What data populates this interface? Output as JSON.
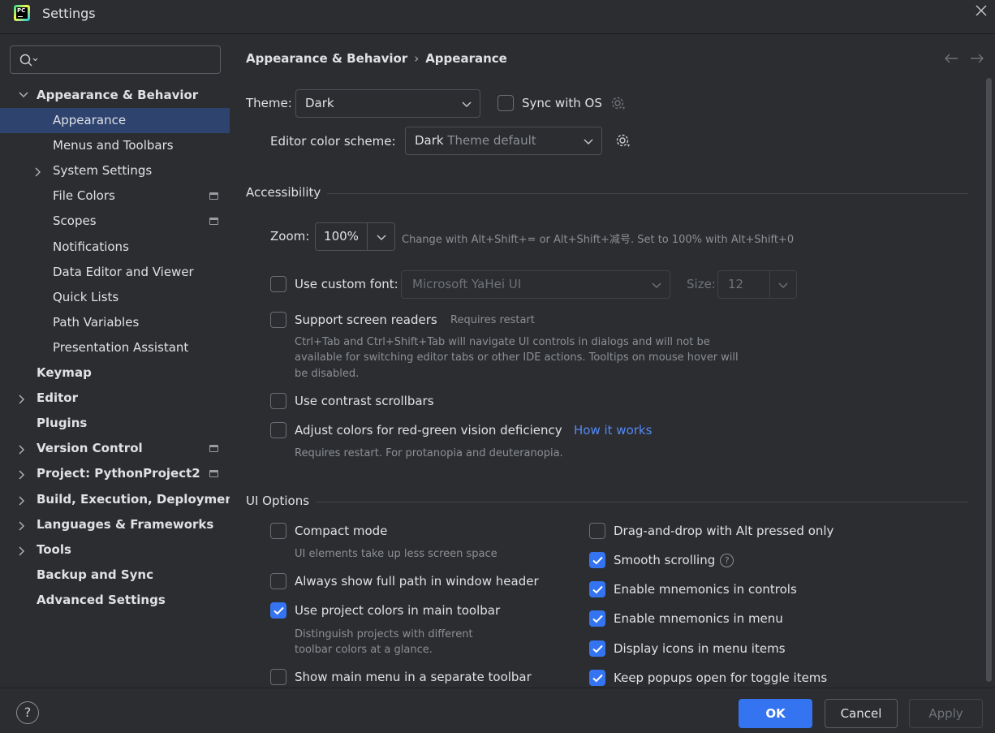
{
  "window": {
    "title": "Settings",
    "app_icon_text": "PC"
  },
  "search": {
    "value": "",
    "placeholder": ""
  },
  "sidebar": {
    "items": [
      {
        "label": "Appearance & Behavior",
        "bold": true,
        "expanded": true,
        "level": 0
      },
      {
        "label": "Appearance",
        "level": 1,
        "selected": true
      },
      {
        "label": "Menus and Toolbars",
        "level": 1
      },
      {
        "label": "System Settings",
        "level": 1,
        "has_children": true
      },
      {
        "label": "File Colors",
        "level": 1,
        "project_scoped": true
      },
      {
        "label": "Scopes",
        "level": 1,
        "project_scoped": true
      },
      {
        "label": "Notifications",
        "level": 1
      },
      {
        "label": "Data Editor and Viewer",
        "level": 1
      },
      {
        "label": "Quick Lists",
        "level": 1
      },
      {
        "label": "Path Variables",
        "level": 1
      },
      {
        "label": "Presentation Assistant",
        "level": 1
      },
      {
        "label": "Keymap",
        "bold": true,
        "level": 0
      },
      {
        "label": "Editor",
        "bold": true,
        "level": 0,
        "has_children": true
      },
      {
        "label": "Plugins",
        "bold": true,
        "level": 0
      },
      {
        "label": "Version Control",
        "bold": true,
        "level": 0,
        "has_children": true,
        "project_scoped": true
      },
      {
        "label": "Project: PythonProject2",
        "bold": true,
        "level": 0,
        "has_children": true,
        "project_scoped": true
      },
      {
        "label": "Build, Execution, Deployment",
        "bold": true,
        "level": 0,
        "has_children": true
      },
      {
        "label": "Languages & Frameworks",
        "bold": true,
        "level": 0,
        "has_children": true
      },
      {
        "label": "Tools",
        "bold": true,
        "level": 0,
        "has_children": true
      },
      {
        "label": "Backup and Sync",
        "bold": true,
        "level": 0
      },
      {
        "label": "Advanced Settings",
        "bold": true,
        "level": 0
      }
    ]
  },
  "breadcrumb": {
    "parent": "Appearance & Behavior",
    "separator": "›",
    "current": "Appearance",
    "back_icon": "arrow-left-icon",
    "forward_icon": "arrow-right-icon"
  },
  "theme": {
    "label": "Theme:",
    "value": "Dark",
    "sync_label": "Sync with OS",
    "sync_checked": false
  },
  "editor_scheme": {
    "label": "Editor color scheme:",
    "value_main": "Dark",
    "value_suffix": "Theme default"
  },
  "accessibility": {
    "title": "Accessibility",
    "zoom_label": "Zoom:",
    "zoom_value": "100%",
    "zoom_hint": "Change with Alt+Shift+= or Alt+Shift+减号. Set to 100% with Alt+Shift+0",
    "custom_font_label": "Use custom font:",
    "custom_font_checked": false,
    "font_value": "Microsoft YaHei UI",
    "size_label": "Size:",
    "size_value": "12",
    "screen_readers_label": "Support screen readers",
    "screen_readers_checked": false,
    "screen_readers_hint": "Requires restart",
    "screen_readers_desc_1": "Ctrl+Tab and Ctrl+Shift+Tab will navigate UI controls in dialogs and will not be",
    "screen_readers_desc_2": "available for switching editor tabs or other IDE actions. Tooltips on mouse hover will",
    "screen_readers_desc_3": "be disabled.",
    "contrast_label": "Use contrast scrollbars",
    "contrast_checked": false,
    "redgreen_label": "Adjust colors for red-green vision deficiency",
    "redgreen_checked": false,
    "redgreen_link": "How it works",
    "redgreen_desc": "Requires restart. For protanopia and deuteranopia."
  },
  "ui_options": {
    "title": "UI Options",
    "compact_label": "Compact mode",
    "compact_checked": false,
    "compact_desc": "UI elements take up less screen space",
    "full_path_label": "Always show full path in window header",
    "full_path_checked": false,
    "project_colors_label": "Use project colors in main toolbar",
    "project_colors_checked": true,
    "project_colors_desc_1": "Distinguish projects with different",
    "project_colors_desc_2": "toolbar colors at a glance.",
    "main_menu_label": "Show main menu in a separate toolbar",
    "main_menu_checked": false,
    "dnd_label": "Drag-and-drop with Alt pressed only",
    "dnd_checked": false,
    "smooth_label": "Smooth scrolling",
    "smooth_checked": true,
    "mnemonics_controls_label": "Enable mnemonics in controls",
    "mnemonics_controls_checked": true,
    "mnemonics_menu_label": "Enable mnemonics in menu",
    "mnemonics_menu_checked": true,
    "icons_menu_label": "Display icons in menu items",
    "icons_menu_checked": true,
    "popups_label": "Keep popups open for toggle items",
    "popups_checked": true
  },
  "footer": {
    "help": "?",
    "ok": "OK",
    "cancel": "Cancel",
    "apply": "Apply"
  },
  "colors": {
    "background": "#2b2d30",
    "accent": "#3574f0",
    "selection": "#2e436e",
    "link": "#548af7"
  }
}
